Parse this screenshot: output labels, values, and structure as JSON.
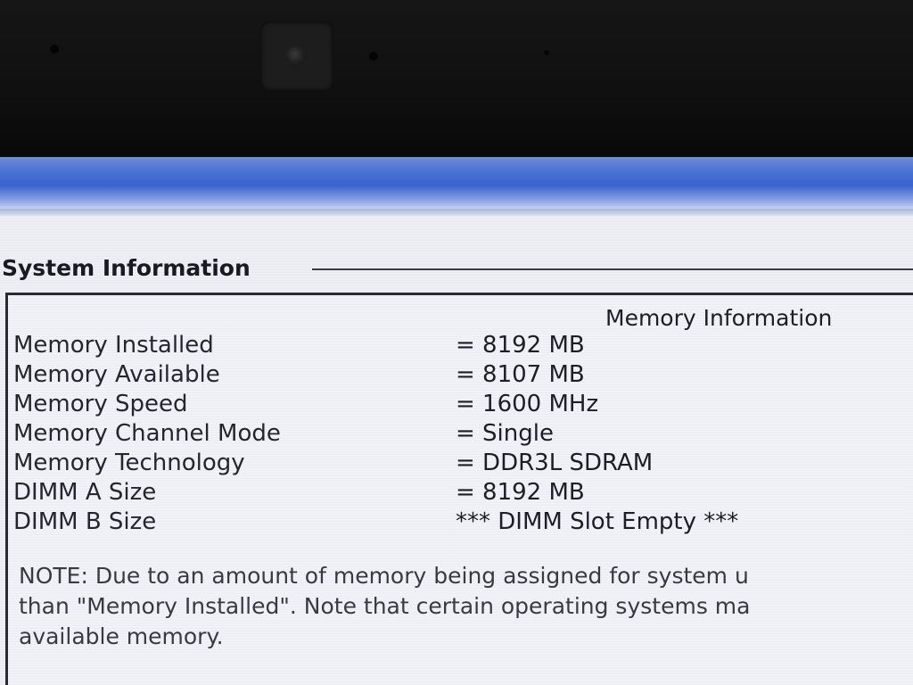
{
  "panel": {
    "group_title": "System Information",
    "section_heading": "Memory Information"
  },
  "memory_rows": [
    {
      "label": "Memory Installed",
      "value": "= 8192 MB"
    },
    {
      "label": "Memory Available",
      "value": "= 8107 MB"
    },
    {
      "label": "Memory Speed",
      "value": "= 1600 MHz"
    },
    {
      "label": "Memory Channel Mode",
      "value": "= Single"
    },
    {
      "label": "Memory Technology",
      "value": "= DDR3L SDRAM"
    },
    {
      "label": "DIMM A Size",
      "value": "= 8192 MB"
    },
    {
      "label": "DIMM B Size",
      "value": "*** DIMM Slot Empty ***"
    }
  ],
  "note": {
    "line1": "NOTE: Due to an amount of memory being assigned for system u",
    "line2": "than \"Memory Installed\". Note that certain operating systems ma",
    "line3": "available memory."
  },
  "colors": {
    "title_bar_blue": "#3a64d0",
    "screen_background": "#eef0f6",
    "bezel": "#0f0f0f"
  },
  "icons": {
    "webcam": "webcam-icon"
  }
}
